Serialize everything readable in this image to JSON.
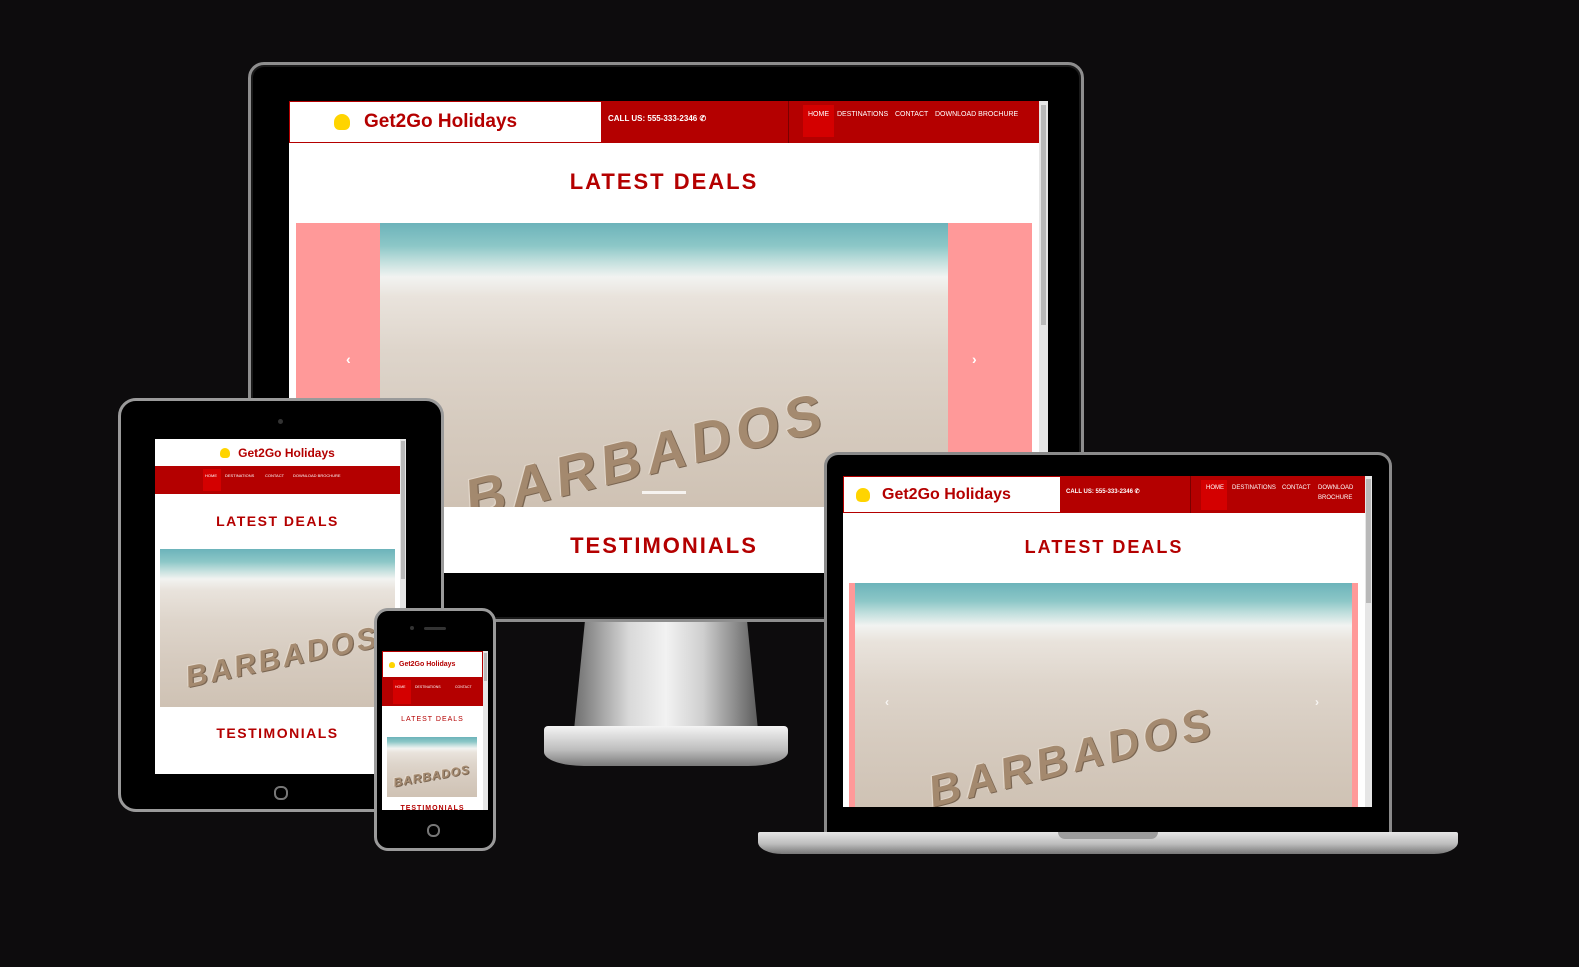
{
  "site": {
    "brand": "Get2Go Holidays",
    "call_text": "CALL US: 555-333-2346",
    "call_text_laptop": "CALL US: 555-333-2346",
    "phone_icon": "phone-icon",
    "logo_icon": "hat-logo-icon"
  },
  "nav": {
    "home": "HOME",
    "destinations": "DESTINATIONS",
    "contact": "CONTACT",
    "download": "DOWNLOAD BROCHURE",
    "download_line1": "DOWNLOAD",
    "download_line2": "BROCHURE"
  },
  "sections": {
    "latest_deals": "LATEST DEALS",
    "testimonials": "TESTIMONIALS"
  },
  "carousel": {
    "sand_text": "BARBADOS",
    "prev_icon": "chevron-left-icon",
    "next_icon": "chevron-right-icon",
    "prev_glyph": "‹",
    "next_glyph": "›"
  },
  "colors": {
    "brand_red": "#b40000",
    "active_red": "#d40000",
    "carousel_control": "#ff9999",
    "logo_yellow": "#ffd400",
    "background": "#0d0c0d"
  }
}
